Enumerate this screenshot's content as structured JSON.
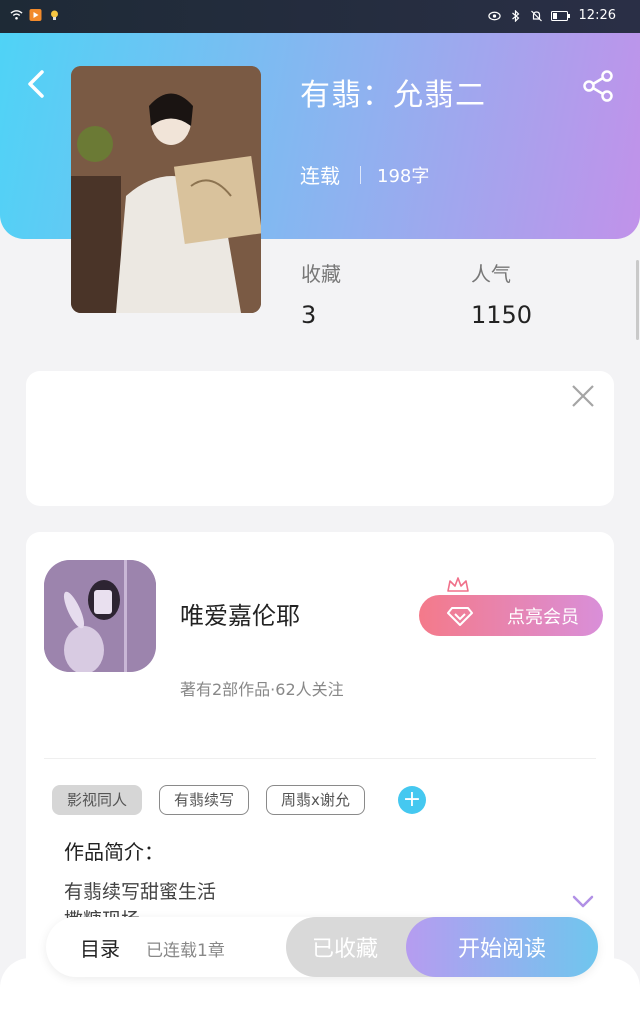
{
  "status_bar": {
    "time": "12:26"
  },
  "book": {
    "title": "有翡：允翡二",
    "status": "连载",
    "word_count": "198字",
    "stats": [
      {
        "label": "收藏",
        "value": "3"
      },
      {
        "label": "人气",
        "value": "1150"
      }
    ]
  },
  "author": {
    "name": "唯爱嘉伦耶",
    "meta": "著有2部作品·62人关注",
    "vip_button": "点亮会员"
  },
  "tags": [
    "影视同人",
    "有翡续写",
    "周翡x谢允"
  ],
  "add_tag_symbol": "+",
  "intro": {
    "title": "作品简介：",
    "lines": [
      "有翡续写甜蜜生活",
      "撒糖现场"
    ]
  },
  "bottom_bar": {
    "toc_label": "目录",
    "toc_sub": "已连载1章",
    "favorited_label": "已收藏",
    "read_label": "开始阅读"
  },
  "icons": {
    "back": "chevron-left-icon",
    "share": "share-icon",
    "close": "close-icon",
    "vip": "diamond-icon",
    "crown": "crown-icon",
    "more": "chevron-down-icon"
  },
  "colors": {
    "header_start": "#4fd3f6",
    "header_end": "#c192ea",
    "vip_start": "#f47a8a",
    "vip_end": "#d98fd9",
    "read_start": "#b69cf0",
    "read_end": "#6fc6ee",
    "tag_add": "#45c8f0"
  }
}
